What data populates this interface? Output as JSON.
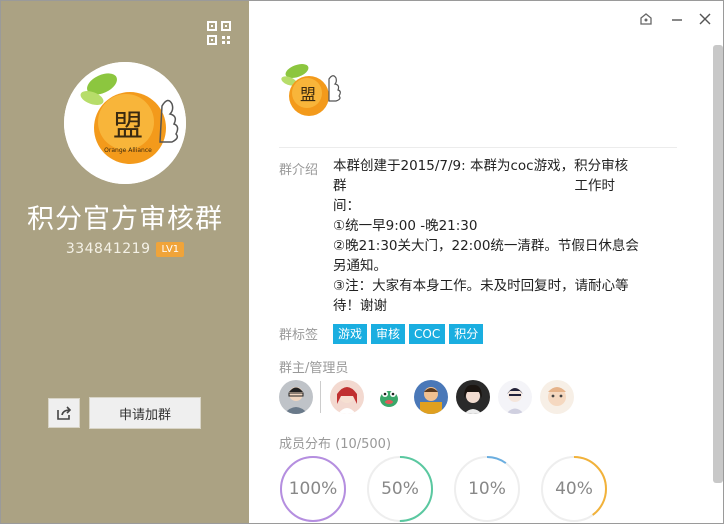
{
  "group": {
    "name": "积分官方审核群",
    "id": "334841219",
    "level": "LV1",
    "join_button": "申请加群",
    "logo_char": "盟",
    "logo_sub": "Orange Alliance"
  },
  "window": {
    "controls": [
      "skin-icon",
      "minimize-icon",
      "close-icon"
    ]
  },
  "info": {
    "intro_label": "群介绍",
    "intro_line1": "本群创建于2015/7/9:  本群为coc游戏，积分审核",
    "intro_line2a": "群",
    "intro_line2b": "工作时",
    "intro_line3": "间：",
    "intro_line4": "①统一早9:00 -晚21:30",
    "intro_line5": "②晚21:30关大门，22:00统一清群。节假日休息会",
    "intro_line6": "另通知。",
    "intro_line7": "③注：大家有本身工作。未及时回复时，请耐心等",
    "intro_line8": "待！谢谢",
    "tags_label": "群标签",
    "tags": [
      "游戏",
      "审核",
      "COC",
      "积分"
    ],
    "admins_label": "群主/管理员",
    "members_label": "成员分布 (10/500)",
    "stats": [
      {
        "label": "100%",
        "value": 1.0,
        "color": "#b58ee0"
      },
      {
        "label": "50%",
        "value": 0.5,
        "color": "#5ac8a0"
      },
      {
        "label": "10%",
        "value": 0.1,
        "color": "#6aaee0"
      },
      {
        "label": "40%",
        "value": 0.4,
        "color": "#f2b23a"
      }
    ]
  }
}
